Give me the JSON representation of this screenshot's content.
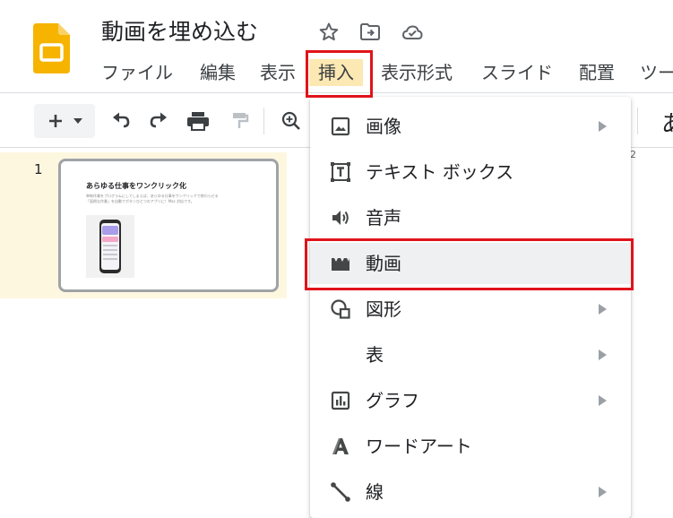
{
  "document": {
    "title": "動画を埋め込む"
  },
  "header_icons": [
    "star-icon",
    "move-to-folder-icon",
    "cloud-saved-icon"
  ],
  "menu": {
    "items": [
      {
        "id": "file",
        "label": "ファイル"
      },
      {
        "id": "edit",
        "label": "編集"
      },
      {
        "id": "view",
        "label": "表示"
      },
      {
        "id": "insert",
        "label": "挿入",
        "active": true
      },
      {
        "id": "format",
        "label": "表示形式"
      },
      {
        "id": "slide",
        "label": "スライド"
      },
      {
        "id": "arrange",
        "label": "配置"
      },
      {
        "id": "tools",
        "label": "ツー"
      }
    ]
  },
  "toolbar": {
    "icons": [
      "add-icon",
      "dropdown-arrow-icon",
      "undo-icon",
      "redo-icon",
      "print-icon",
      "paint-format-icon",
      "zoom-icon"
    ],
    "ruler_mark": "2",
    "right_text": "あ"
  },
  "filmstrip": {
    "slides": [
      {
        "number": "1",
        "title": "あらゆる仕事をワンクリック化",
        "body_line1": "単純作業をプログラムにしてしまえば、あらゆる仕事をワンクリックで終わらせる",
        "body_line2": "「面倒な作業」を自動でボタンひとつのアプリに！Mac 対応です。"
      }
    ]
  },
  "insert_menu": {
    "items": [
      {
        "id": "image",
        "label": "画像",
        "icon": "image-icon",
        "submenu": true
      },
      {
        "id": "textbox",
        "label": "テキスト ボックス",
        "icon": "text-box-icon",
        "submenu": false
      },
      {
        "id": "audio",
        "label": "音声",
        "icon": "audio-icon",
        "submenu": false
      },
      {
        "id": "video",
        "label": "動画",
        "icon": "video-icon",
        "submenu": false,
        "highlighted": true
      },
      {
        "id": "shape",
        "label": "図形",
        "icon": "shape-icon",
        "submenu": true
      },
      {
        "id": "table",
        "label": "表",
        "icon": "",
        "submenu": true
      },
      {
        "id": "chart",
        "label": "グラフ",
        "icon": "chart-icon",
        "submenu": true
      },
      {
        "id": "wordart",
        "label": "ワードアート",
        "icon": "wordart-icon",
        "submenu": false
      },
      {
        "id": "line",
        "label": "線",
        "icon": "line-icon",
        "submenu": true
      }
    ]
  },
  "colors": {
    "highlight_border": "#e0131b",
    "active_menu_bg": "#fce8b2",
    "hover_item_bg": "#eef0f2",
    "logo_yellow": "#f6b400",
    "selected_slide_bg": "#fef7e0"
  }
}
